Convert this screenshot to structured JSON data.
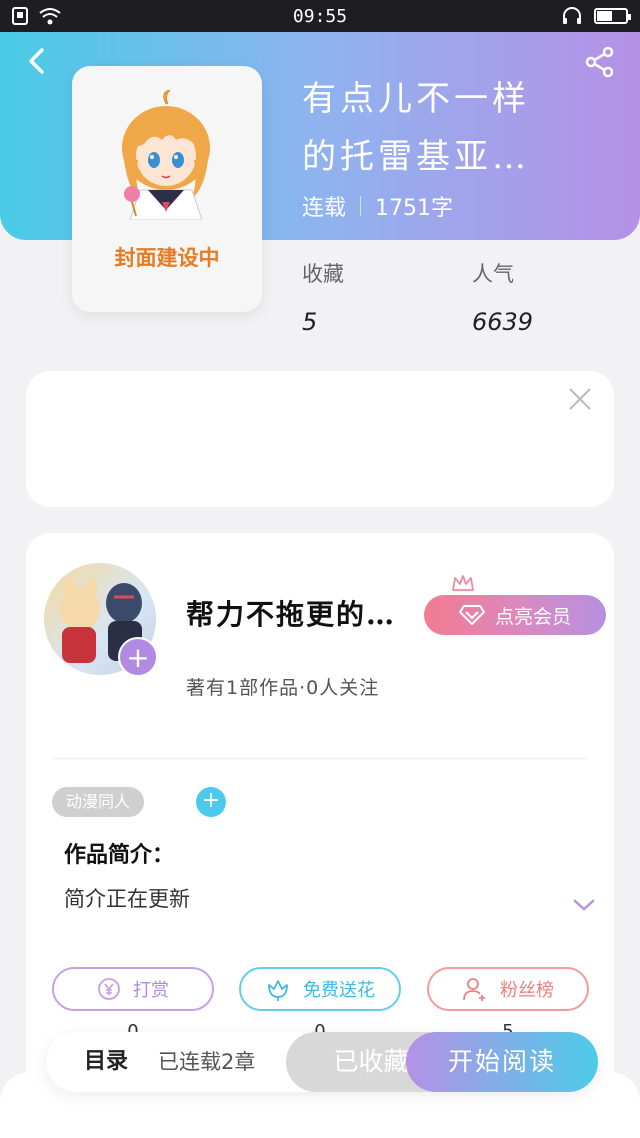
{
  "status_bar": {
    "time": "09:55",
    "battery_level": 0.5
  },
  "book": {
    "title_line1": "有点儿不一样",
    "title_line2": "的托雷基亚…",
    "status": "连载",
    "word_count": "1751字",
    "cover_label": "封面建设中",
    "stats": {
      "favorites_label": "收藏",
      "favorites_value": "5",
      "popularity_label": "人气",
      "popularity_value": "6639"
    }
  },
  "author": {
    "name": "帮力不拖更的…",
    "vip_label": "点亮会员",
    "meta": "著有1部作品·0人关注",
    "tag": "动漫同人",
    "intro_title": "作品简介：",
    "intro_text": "简介正在更新"
  },
  "actions": [
    {
      "label": "打赏",
      "count": "0",
      "color": "#b48ae0"
    },
    {
      "label": "免费送花",
      "count": "0",
      "color": "#3fb9e2"
    },
    {
      "label": "粉丝榜",
      "count": "5",
      "color": "#ec8080"
    }
  ],
  "bottom_bar": {
    "toc_label": "目录",
    "chapter_status": "已连载2章",
    "collected_label": "已收藏",
    "read_label": "开始阅读"
  },
  "icons": [
    "back-icon",
    "share-icon",
    "close-icon",
    "crown-icon",
    "diamond-icon",
    "plus-icon",
    "chevron-down-icon",
    "yen-icon",
    "flower-icon",
    "fan-rank-icon",
    "wifi-icon",
    "headphone-icon",
    "battery-icon"
  ]
}
